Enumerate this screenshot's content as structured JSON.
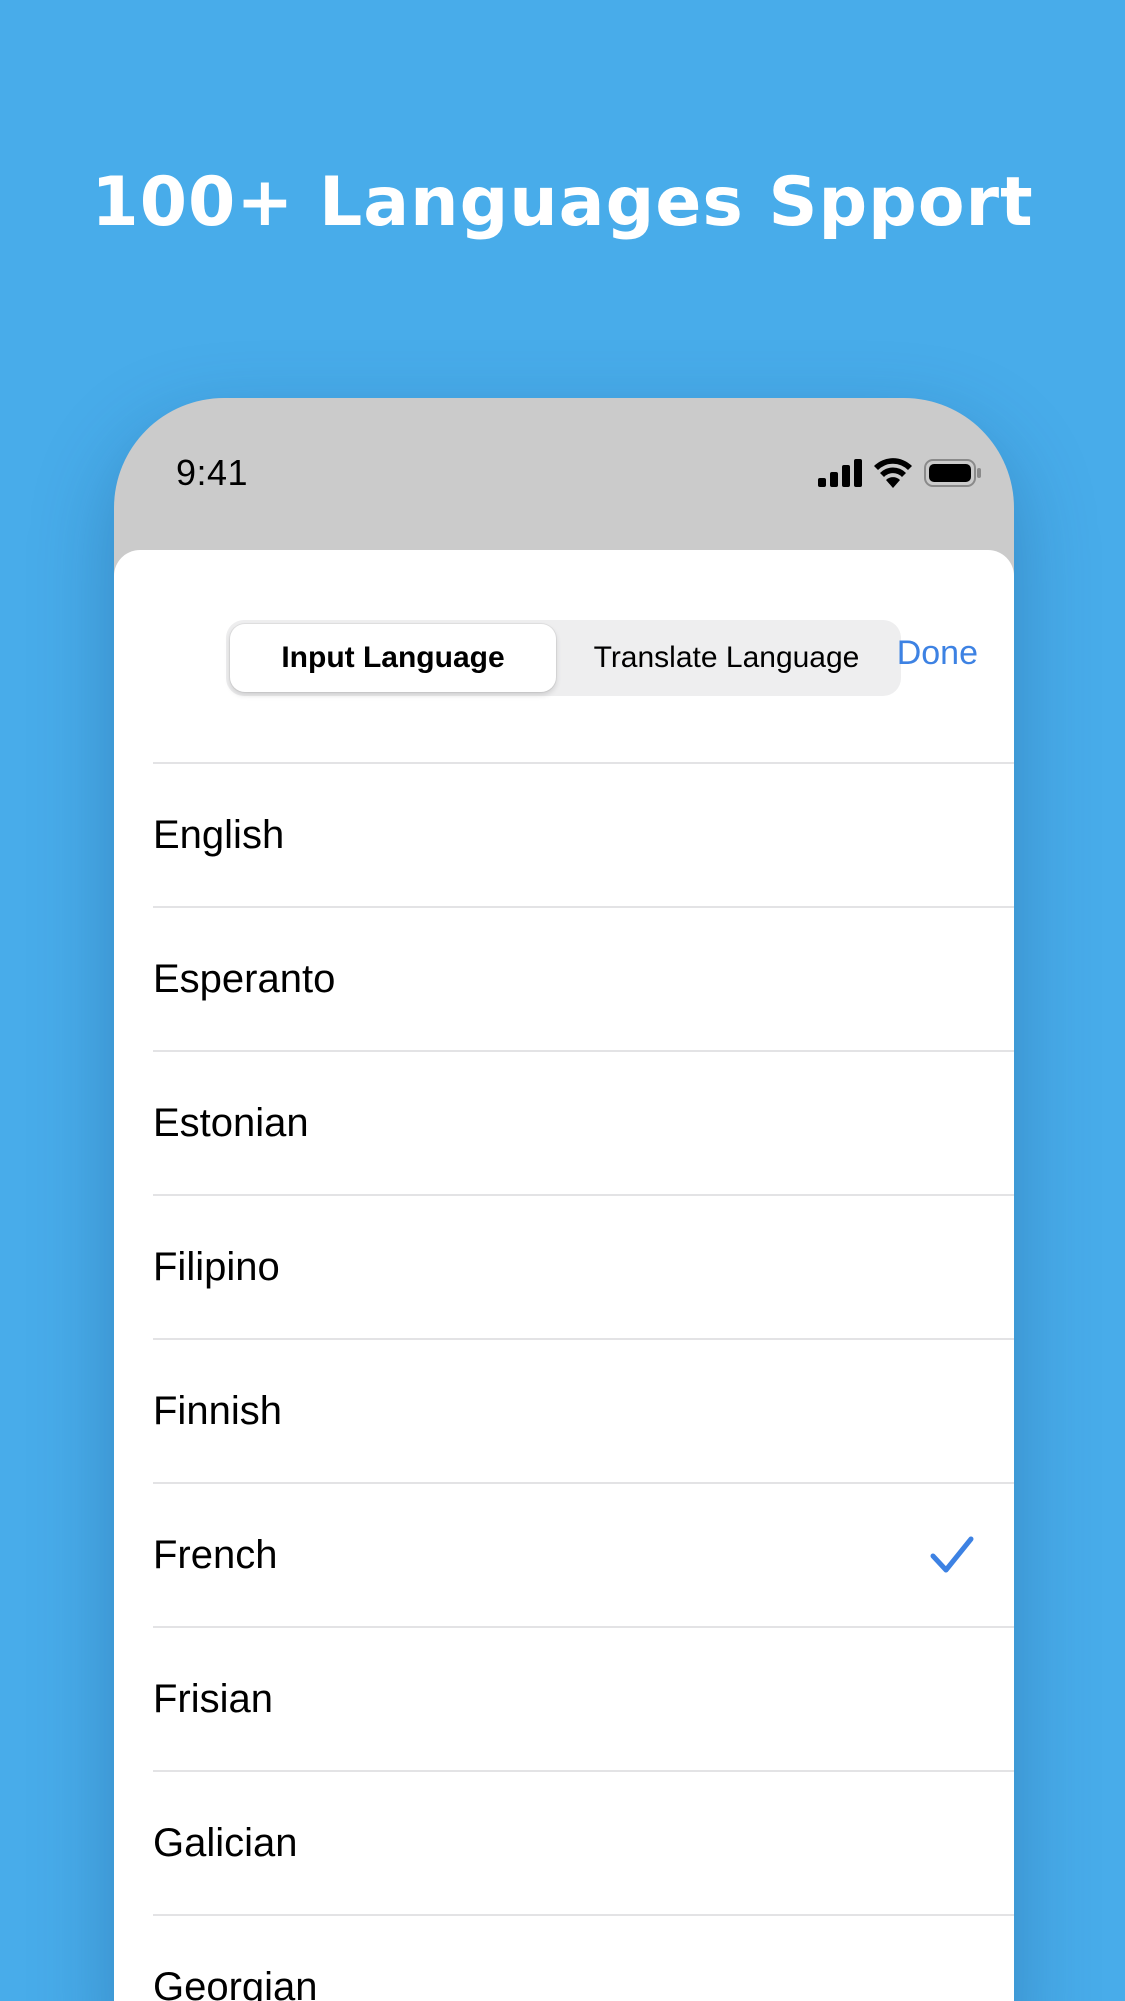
{
  "promo": {
    "headline": "100+ Languages Spport"
  },
  "status_bar": {
    "time": "9:41",
    "icons": [
      "cellular-signal-icon",
      "wifi-icon",
      "battery-icon"
    ]
  },
  "picker": {
    "segments": [
      {
        "label": "Input Language",
        "selected": true
      },
      {
        "label": "Translate Language",
        "selected": false
      }
    ],
    "done_label": "Done"
  },
  "languages": [
    {
      "name": "English",
      "selected": false
    },
    {
      "name": "Esperanto",
      "selected": false
    },
    {
      "name": "Estonian",
      "selected": false
    },
    {
      "name": "Filipino",
      "selected": false
    },
    {
      "name": "Finnish",
      "selected": false
    },
    {
      "name": "French",
      "selected": true
    },
    {
      "name": "Frisian",
      "selected": false
    },
    {
      "name": "Galician",
      "selected": false
    },
    {
      "name": "Georgian",
      "selected": false
    }
  ],
  "colors": {
    "background": "#48acea",
    "accent": "#3d82e3",
    "phone_header": "#cbcbcb",
    "divider": "#e3e3e5"
  }
}
